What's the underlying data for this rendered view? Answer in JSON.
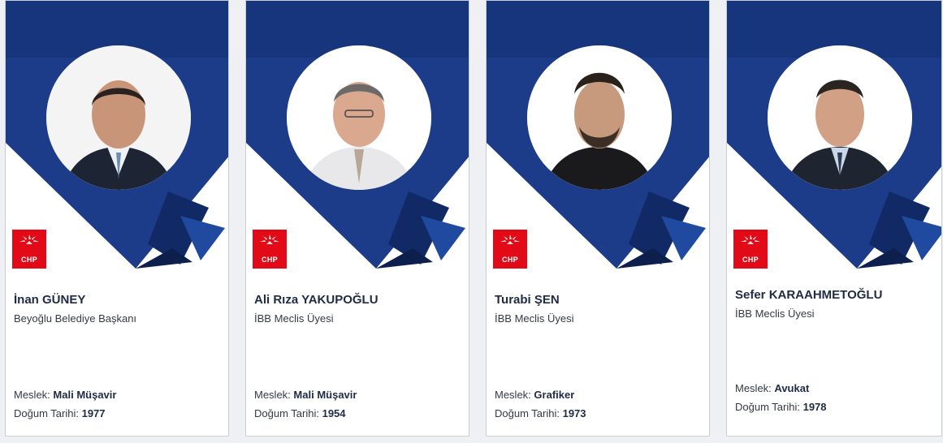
{
  "cards": [
    {
      "name": "İnan GÜNEY",
      "title": "Beyoğlu Belediye Başkanı",
      "profession_label": "Meslek:",
      "profession": "Mali Müşavir",
      "birth_label": "Doğum Tarihi:",
      "birth_year": "1977",
      "logo_text": "CHP"
    },
    {
      "name": "Ali Rıza YAKUPOĞLU",
      "title": "İBB Meclis Üyesi",
      "profession_label": "Meslek:",
      "profession": "Mali Müşavir",
      "birth_label": "Doğum Tarihi:",
      "birth_year": "1954",
      "logo_text": "CHP"
    },
    {
      "name": "Turabi ŞEN",
      "title": "İBB Meclis Üyesi",
      "profession_label": "Meslek:",
      "profession": "Grafiker",
      "birth_label": "Doğum Tarihi:",
      "birth_year": "1973",
      "logo_text": "CHP"
    },
    {
      "name": "Sefer KARAAHMETOĞLU",
      "title": "İBB Meclis Üyesi",
      "profession_label": "Meslek:",
      "profession": "Avukat",
      "birth_label": "Doğum Tarihi:",
      "birth_year": "1978",
      "logo_text": "CHP"
    }
  ],
  "colors": {
    "ribbon_dark": "#14285f",
    "ribbon_mid": "#1e4494",
    "ribbon_light": "#2f5bb8",
    "chp_red": "#e30a17"
  },
  "icons": [
    "person-photo",
    "chp-logo-icon"
  ]
}
